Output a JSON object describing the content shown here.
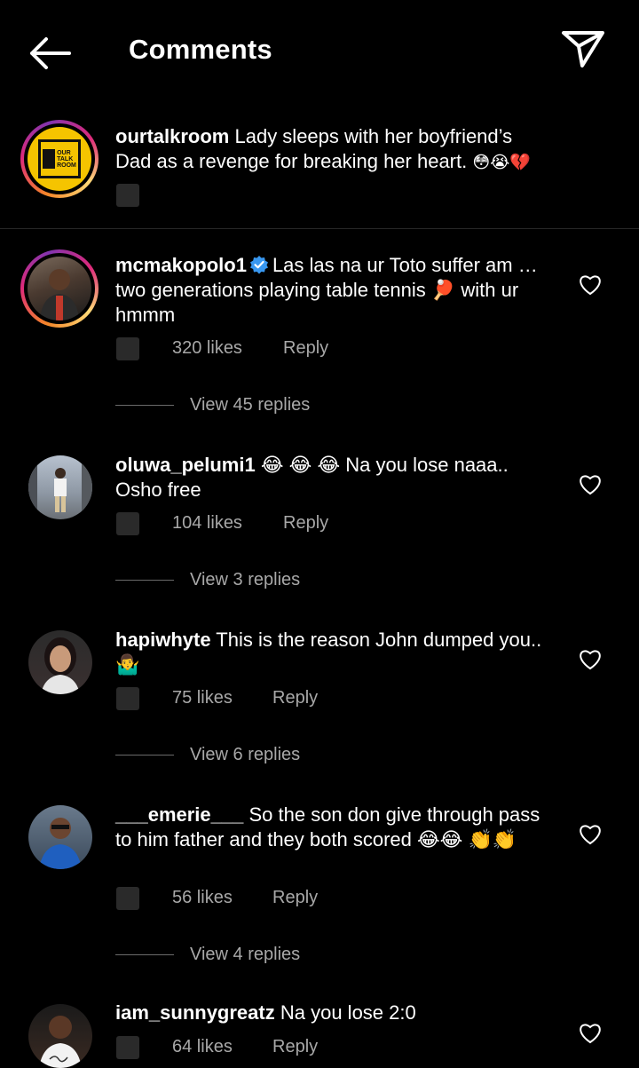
{
  "header": {
    "title": "Comments"
  },
  "caption": {
    "username": "ourtalkroom",
    "text": "Lady sleeps with her boyfriend’s Dad as a revenge for breaking her heart.",
    "emoji": "😳😭💔",
    "logo_text_1": "OUR",
    "logo_text_2": "TALK",
    "logo_text_3": "ROOM"
  },
  "comments": [
    {
      "username": "mcmakopolo1",
      "verified": true,
      "text": "Las las na ur Toto suffer am … two generations playing table tennis 🏓 with ur hmmm",
      "likes": "320 likes",
      "reply": "Reply",
      "view_replies": "View 45 replies"
    },
    {
      "username": "oluwa_pelumi1",
      "text": "😂 😂 😂 Na you lose naaa.. Osho free",
      "likes": "104 likes",
      "reply": "Reply",
      "view_replies": "View 3 replies"
    },
    {
      "username": "hapiwhyte",
      "text": "This is the reason John dumped you..🤷‍♂️",
      "likes": "75 likes",
      "reply": "Reply",
      "view_replies": "View 6 replies"
    },
    {
      "username": "___emerie___",
      "text": "So the son don give through pass to him father and they both scored 😂😂 👏👏",
      "likes": "56 likes",
      "reply": "Reply",
      "view_replies": "View 4 replies"
    },
    {
      "username": "iam_sunnygreatz",
      "text": "Na you lose 2:0",
      "likes": "64 likes",
      "reply": "Reply"
    }
  ],
  "icons": {
    "back": "arrow-left-icon",
    "send": "paper-plane-icon",
    "like": "heart-outline-icon",
    "verified": "verified-badge-icon"
  },
  "colors": {
    "background": "#000000",
    "text": "#ffffff",
    "secondary": "#a8a8a8",
    "verified": "#3897f0",
    "logo_yellow": "#f5c400"
  }
}
